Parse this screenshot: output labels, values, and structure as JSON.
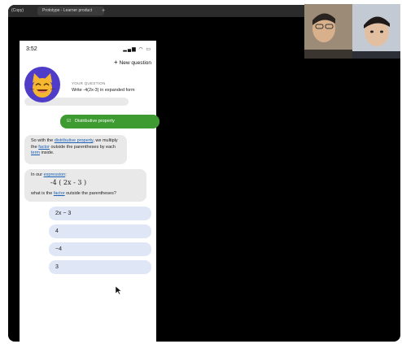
{
  "browser": {
    "tabs": [
      {
        "label": "(Copy)"
      },
      {
        "label": "Prototype - Learner product"
      },
      {
        "label": "+"
      }
    ]
  },
  "phone": {
    "status_time": "3:52",
    "new_question_label": "New question",
    "your_question_label": "YOUR QUESTION",
    "your_question_text": "Write -4(2x-3) in expanded form",
    "partial_bubble_text": "...?",
    "selected_answer": "Distributive property",
    "message1": {
      "pre": "So with the ",
      "link1": "distributive property",
      "mid1": ", we multiply the ",
      "link2": "factor",
      "mid2": " outside the parentheses by each ",
      "link3": "term",
      "post": " inside."
    },
    "message2": {
      "pre": "In our ",
      "link": "expression",
      "post": ":",
      "expression": "-4 ( 2x - 3 )",
      "q_pre": "what is the ",
      "q_link": "factor",
      "q_post": " outside the parentheses?"
    },
    "options": [
      {
        "label": "2x − 3"
      },
      {
        "label": "4"
      },
      {
        "label": "−4"
      },
      {
        "label": "3"
      }
    ]
  },
  "colors": {
    "accent_green": "#3e9b32",
    "option_bg": "#dfe7f6",
    "link": "#1a5fb4",
    "avatar_bg": "#4f3cc9"
  },
  "icons": {
    "avatar": "cat-emoji-icon",
    "check": "checkbox-icon",
    "cursor": "mouse-cursor-icon"
  }
}
